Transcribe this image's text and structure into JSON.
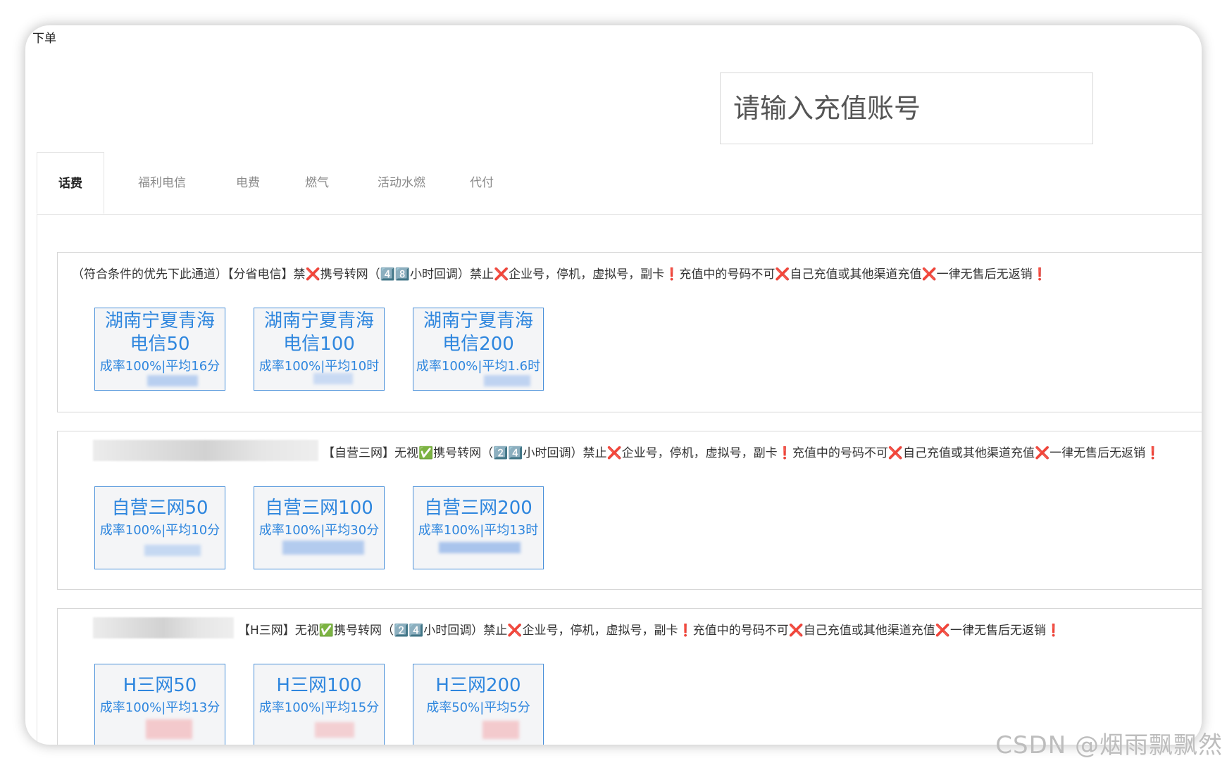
{
  "page": {
    "title": "下单"
  },
  "account_input": {
    "placeholder": "请输入充值账号",
    "value": ""
  },
  "tabs": [
    {
      "label": "话费",
      "active": true
    },
    {
      "label": "福利电信",
      "active": false
    },
    {
      "label": "电费",
      "active": false
    },
    {
      "label": "燃气",
      "active": false
    },
    {
      "label": "活动水燃",
      "active": false
    },
    {
      "label": "代付",
      "active": false
    }
  ],
  "panels": [
    {
      "notice": "（符合条件的优先下此通道）【分省电信】禁❌携号转网（4️⃣8️⃣小时回调）禁止❌企业号，停机，虚拟号，副卡❗充值中的号码不可❌自己充值或其他渠道充值❌一律无售后无返销❗",
      "products": [
        {
          "name": "湖南宁夏青海电信50",
          "rate": "成率100%|平均16分"
        },
        {
          "name": "湖南宁夏青海电信100",
          "rate": "成率100%|平均10时"
        },
        {
          "name": "湖南宁夏青海电信200",
          "rate": "成率100%|平均1.6时"
        }
      ]
    },
    {
      "notice": "【自营三网】无视✅携号转网（2️⃣4️⃣小时回调）禁止❌企业号，停机，虚拟号，副卡❗充值中的号码不可❌自己充值或其他渠道充值❌一律无售后无返销❗",
      "products": [
        {
          "name": "自营三网50",
          "rate": "成率100%|平均10分"
        },
        {
          "name": "自营三网100",
          "rate": "成率100%|平均30分"
        },
        {
          "name": "自营三网200",
          "rate": "成率100%|平均13时"
        }
      ]
    },
    {
      "notice": "【H三网】无视✅携号转网（2️⃣4️⃣小时回调）禁止❌企业号，停机，虚拟号，副卡❗充值中的号码不可❌自己充值或其他渠道充值❌一律无售后无返销❗",
      "products": [
        {
          "name": "H三网50",
          "rate": "成率100%|平均13分"
        },
        {
          "name": "H三网100",
          "rate": "成率100%|平均15分"
        },
        {
          "name": "H三网200",
          "rate": "成率50%|平均5分"
        }
      ]
    }
  ],
  "watermark": "CSDN @烟雨飘飘然",
  "colors": {
    "accent": "#2e86de",
    "border": "#4a90d9",
    "card_bg": "#f4f5f7",
    "redacted_price": "#f3c9cc"
  }
}
